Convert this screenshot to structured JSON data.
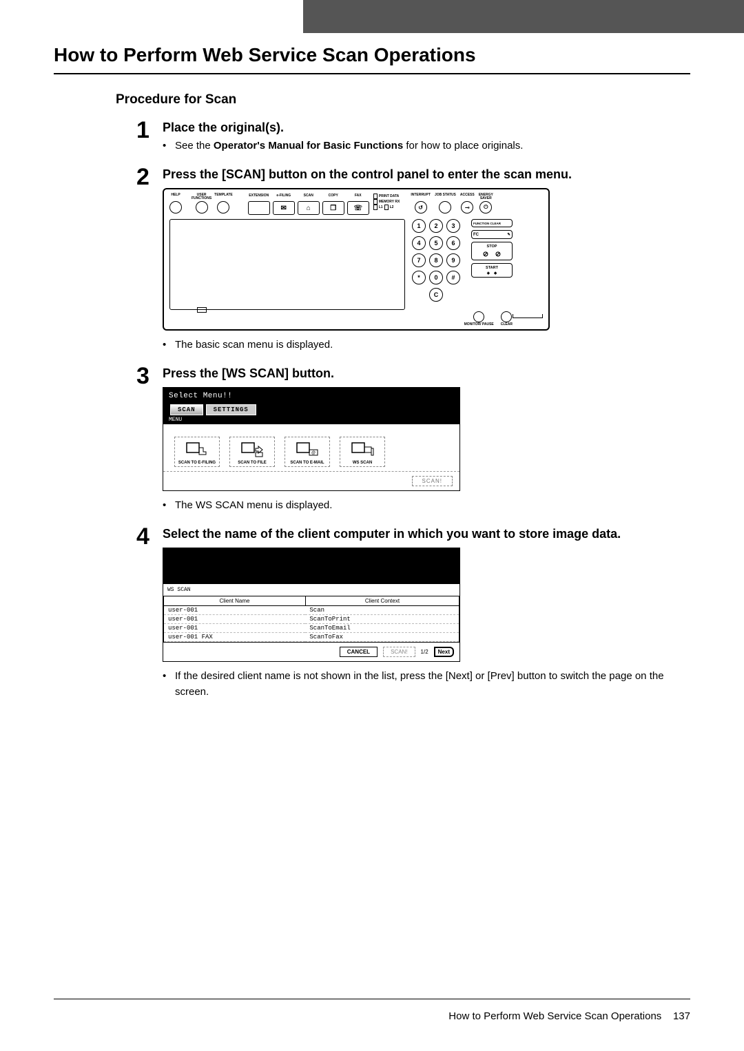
{
  "header": {
    "title": "How to Perform Web Service Scan Operations"
  },
  "section": {
    "title": "Procedure for Scan"
  },
  "steps": {
    "s1": {
      "num": "1",
      "title": "Place the original(s).",
      "bullet_pre": "See the ",
      "bullet_bold": "Operator's Manual for Basic Functions",
      "bullet_post": " for how to place originals."
    },
    "s2": {
      "num": "2",
      "title": "Press the [SCAN] button on the control panel to enter the scan menu.",
      "after": "The basic scan menu is displayed."
    },
    "s3": {
      "num": "3",
      "title": "Press the [WS SCAN] button.",
      "after": "The WS SCAN menu is displayed."
    },
    "s4": {
      "num": "4",
      "title": "Select the name of the client computer in which you want to store image data.",
      "after": "If the desired client name is not shown in the list, press the [Next] or [Prev] button to switch the page on the screen."
    }
  },
  "panel": {
    "btns": {
      "help": "HELP",
      "userfunc": "USER\nFUNCTIONS",
      "template": "TEMPLATE",
      "extension": "EXTENSION",
      "efiling": "e-FILING",
      "scan": "SCAN",
      "copy": "COPY",
      "fax": "FAX",
      "interrupt": "INTERRUPT",
      "jobstatus": "JOB STATUS",
      "access": "ACCESS",
      "energysaver": "ENERGY\nSAVER"
    },
    "indicators": {
      "print": "PRINT DATA",
      "memory": "MEMORY RX",
      "lines": "L1   L2"
    },
    "ctrl": {
      "fc_title": "FUNCTION CLEAR",
      "fc": "FC",
      "stop": "STOP",
      "start": "START",
      "clear": "CLEAR",
      "monitor": "MONITOR/\nPAUSE"
    },
    "keys": [
      "1",
      "2",
      "3",
      "4",
      "5",
      "6",
      "7",
      "8",
      "9",
      "*",
      "0",
      "#",
      "C"
    ]
  },
  "scanmenu": {
    "title": "Select Menu!!",
    "tab_scan": "SCAN",
    "tab_settings": "SETTINGS",
    "menulabel": "MENU",
    "items": {
      "efiling": "SCAN TO\nE-FILING",
      "file": "SCAN TO\nFILE",
      "email": "SCAN TO\nE-MAIL",
      "ws": "WS SCAN"
    },
    "footer_btn": "SCAN!"
  },
  "wslist": {
    "title": "WS SCAN",
    "col_name": "Client Name",
    "col_context": "Client Context",
    "rows": [
      {
        "name": "user-001",
        "context": "Scan"
      },
      {
        "name": "user-001",
        "context": "ScanToPrint"
      },
      {
        "name": "user-001",
        "context": "ScanToEmail"
      },
      {
        "name": "user-001  FAX",
        "context": "ScanToFax"
      }
    ],
    "cancel": "CANCEL",
    "scan": "SCAN!",
    "page": "1/2",
    "next": "Next"
  },
  "footer": {
    "text": "How to Perform Web Service Scan Operations",
    "page": "137"
  }
}
